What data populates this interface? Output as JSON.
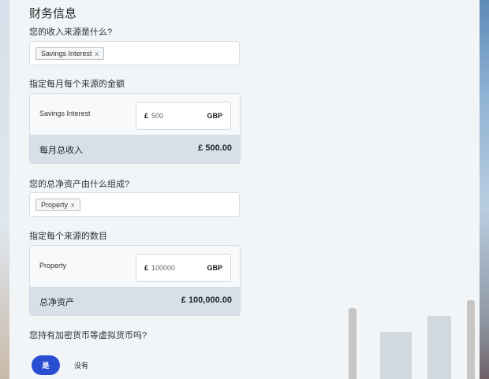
{
  "section": {
    "title": "财务信息"
  },
  "income": {
    "question": "您的收入来源是什么?",
    "tags": [
      {
        "label": "Savings Interest",
        "remove": "x"
      }
    ],
    "amount_question": "指定每月每个来源的金额",
    "rows": [
      {
        "label": "Savings Interest",
        "currency_symbol": "£",
        "value": "500",
        "currency": "GBP"
      }
    ],
    "total_label": "每月总收入",
    "total_value": "£ 500.00"
  },
  "assets": {
    "question": "您的总净资产由什么组成?",
    "tags": [
      {
        "label": "Property",
        "remove": "x"
      }
    ],
    "amount_question": "指定每个来源的数目",
    "rows": [
      {
        "label": "Property",
        "currency_symbol": "£",
        "value": "100000",
        "currency": "GBP"
      }
    ],
    "total_label": "总净资产",
    "total_value": "£ 100,000.00"
  },
  "crypto": {
    "question": "您持有加密货币等虚拟货币吗?",
    "yes_label": "是",
    "no_label": "没有",
    "selected": "yes"
  },
  "colors": {
    "accent": "#2a4ed1",
    "total_bg": "#d7e0e9"
  }
}
